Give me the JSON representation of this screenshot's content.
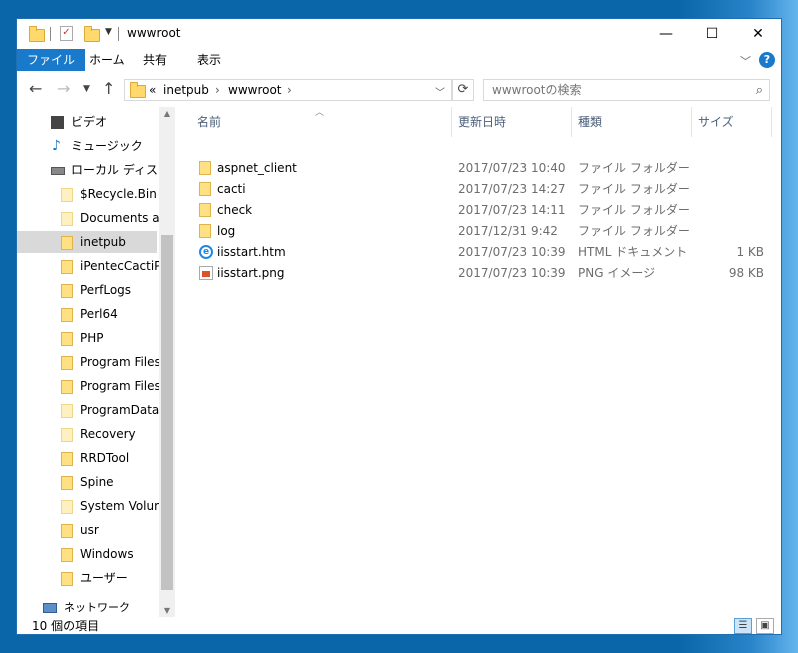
{
  "window": {
    "title": "wwwroot"
  },
  "caption": {
    "minimize": "—",
    "maximize": "☐",
    "close": "✕"
  },
  "ribbon": {
    "tabs": [
      {
        "label": "ファイル",
        "active": true
      },
      {
        "label": "ホーム"
      },
      {
        "label": "共有"
      },
      {
        "label": "表示"
      }
    ],
    "help": "?"
  },
  "address": {
    "overflow": "«",
    "crumbs": [
      "inetpub",
      "wwwroot"
    ]
  },
  "search": {
    "placeholder": "wwwrootの検索"
  },
  "nav": {
    "items": [
      {
        "label": "ビデオ",
        "icon": "video-icon"
      },
      {
        "label": "ミュージック",
        "icon": "music-icon"
      },
      {
        "label": "ローカル ディスク (C",
        "icon": "drive-icon"
      },
      {
        "label": "$Recycle.Bin",
        "icon": "folder-icon-pale"
      },
      {
        "label": "Documents and",
        "icon": "shortcut-folder-icon"
      },
      {
        "label": "inetpub",
        "icon": "folder-icon",
        "selected": true
      },
      {
        "label": "iPentecCactiPo",
        "icon": "folder-icon"
      },
      {
        "label": "PerfLogs",
        "icon": "folder-icon"
      },
      {
        "label": "Perl64",
        "icon": "folder-icon"
      },
      {
        "label": "PHP",
        "icon": "folder-icon"
      },
      {
        "label": "Program Files",
        "icon": "folder-icon"
      },
      {
        "label": "Program Files (",
        "icon": "folder-icon"
      },
      {
        "label": "ProgramData",
        "icon": "folder-icon-pale"
      },
      {
        "label": "Recovery",
        "icon": "folder-icon-pale"
      },
      {
        "label": "RRDTool",
        "icon": "folder-icon"
      },
      {
        "label": "Spine",
        "icon": "folder-icon"
      },
      {
        "label": "System Volume",
        "icon": "folder-icon-pale"
      },
      {
        "label": "usr",
        "icon": "folder-icon"
      },
      {
        "label": "Windows",
        "icon": "folder-icon"
      },
      {
        "label": "ユーザー",
        "icon": "folder-icon"
      },
      {
        "label": "ネットワーク",
        "icon": "network-icon"
      }
    ]
  },
  "columns": {
    "name": "名前",
    "date": "更新日時",
    "type": "種類",
    "size": "サイズ"
  },
  "files": [
    {
      "name": "aspnet_client",
      "date": "2017/07/23 10:40",
      "type": "ファイル フォルダー",
      "size": "",
      "icon": "folder-icon"
    },
    {
      "name": "cacti",
      "date": "2017/07/23 14:27",
      "type": "ファイル フォルダー",
      "size": "",
      "icon": "folder-icon"
    },
    {
      "name": "check",
      "date": "2017/07/23 14:11",
      "type": "ファイル フォルダー",
      "size": "",
      "icon": "folder-icon"
    },
    {
      "name": "log",
      "date": "2017/12/31 9:42",
      "type": "ファイル フォルダー",
      "size": "",
      "icon": "folder-icon"
    },
    {
      "name": "iisstart.htm",
      "date": "2017/07/23 10:39",
      "type": "HTML ドキュメント",
      "size": "1 KB",
      "icon": "html-file-icon"
    },
    {
      "name": "iisstart.png",
      "date": "2017/07/23 10:39",
      "type": "PNG イメージ",
      "size": "98 KB",
      "icon": "png-file-icon"
    }
  ],
  "status": {
    "count": "10 個の項目"
  }
}
